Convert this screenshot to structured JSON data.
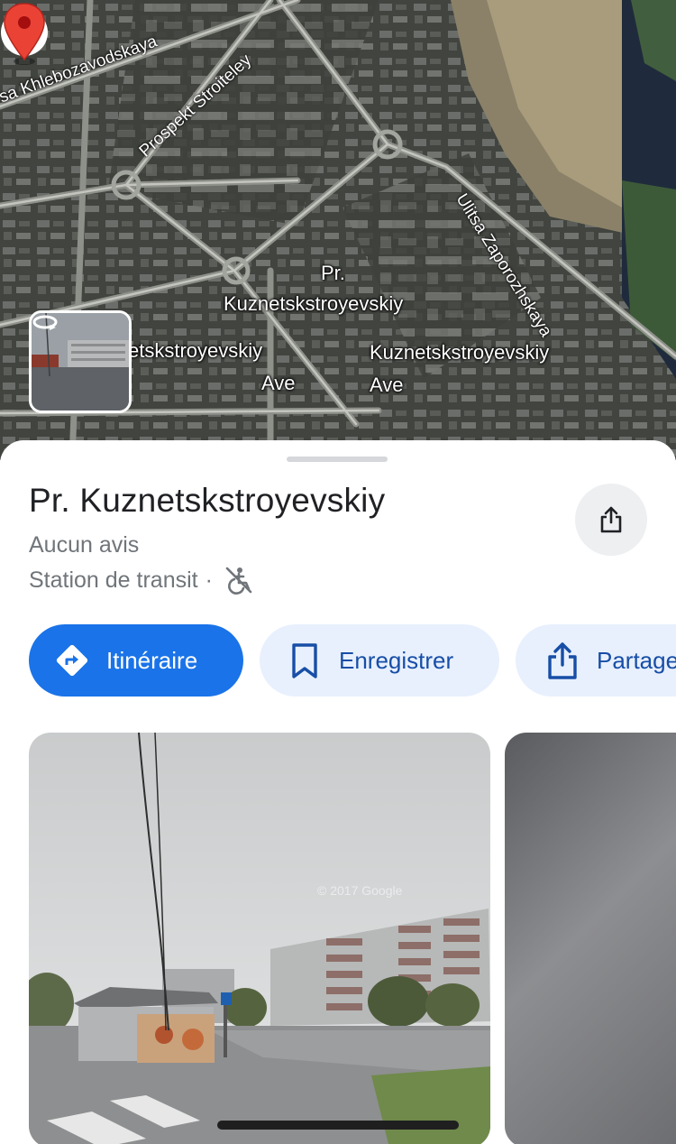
{
  "map": {
    "place_label_line1": "Pr.",
    "place_label_line2": "Kuznetskstroyevskiy",
    "ave_left_line1": "etskstroyevskiy",
    "ave_left_line2": "Ave",
    "ave_right_line1": "Kuznetskstroyevskiy",
    "ave_right_line2": "Ave",
    "street_khlebozavodskaya": "sa Khlebozavodskaya",
    "street_stroiteley": "Prospekt Stroiteley",
    "street_zaporozhskaya": "Ulitsa Zaporozhskaya",
    "pin_color": "#ea4335",
    "street_view_icon": "rotate-360-icon"
  },
  "place": {
    "title": "Pr. Kuznetskstroyevskiy",
    "reviews": "Aucun avis",
    "category": "Station de transit",
    "separator": "·",
    "accessibility_icon": "not-wheelchair-accessible-icon"
  },
  "actions": {
    "directions_label": "Itinéraire",
    "save_label": "Enregistrer",
    "share_label": "Partage"
  },
  "photos": {
    "watermark": "© 2017 Google"
  },
  "colors": {
    "primary": "#1a73e8",
    "chip_bg": "#e8f0fe",
    "chip_text": "#174ea6",
    "title_text": "#202124",
    "secondary_text": "#70757a"
  }
}
